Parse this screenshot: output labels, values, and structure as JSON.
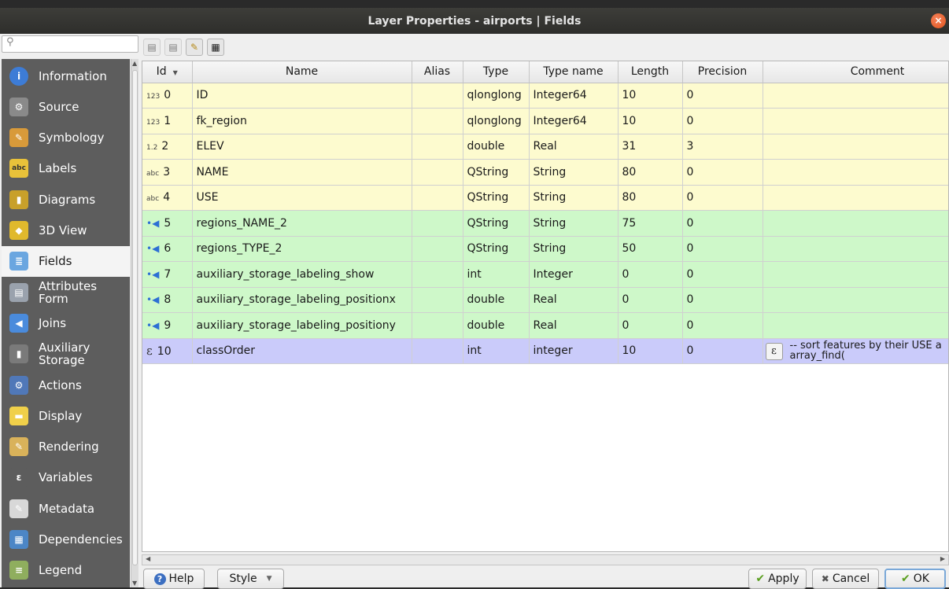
{
  "window": {
    "title": "Layer Properties - airports | Fields"
  },
  "sidebar": {
    "search_placeholder": "",
    "items": [
      {
        "label": "Information",
        "icon": "info-icon",
        "color": "#3d7cd6"
      },
      {
        "label": "Source",
        "icon": "source-icon",
        "color": "#8a8a8a"
      },
      {
        "label": "Symbology",
        "icon": "symbology-icon",
        "color": "#d89a3a"
      },
      {
        "label": "Labels",
        "icon": "labels-icon",
        "color": "#e9c23a"
      },
      {
        "label": "Diagrams",
        "icon": "diagrams-icon",
        "color": "#c8a02a"
      },
      {
        "label": "3D View",
        "icon": "3d-view-icon",
        "color": "#e0b92d"
      },
      {
        "label": "Fields",
        "icon": "fields-icon",
        "color": "#6aa6e0"
      },
      {
        "label": "Attributes Form",
        "icon": "attributes-form-icon",
        "color": "#9aa2ad"
      },
      {
        "label": "Joins",
        "icon": "joins-icon",
        "color": "#4a8bdc"
      },
      {
        "label": "Auxiliary Storage",
        "icon": "auxiliary-storage-icon",
        "color": "#7a7a7a"
      },
      {
        "label": "Actions",
        "icon": "actions-icon",
        "color": "#5078b8"
      },
      {
        "label": "Display",
        "icon": "display-icon",
        "color": "#f0d04a"
      },
      {
        "label": "Rendering",
        "icon": "rendering-icon",
        "color": "#d9b25a"
      },
      {
        "label": "Variables",
        "icon": "variables-icon",
        "color": "#5d5d5d"
      },
      {
        "label": "Metadata",
        "icon": "metadata-icon",
        "color": "#d8d8d8"
      },
      {
        "label": "Dependencies",
        "icon": "dependencies-icon",
        "color": "#4c86c6"
      },
      {
        "label": "Legend",
        "icon": "legend-icon",
        "color": "#8fae5e"
      }
    ]
  },
  "table": {
    "headers": [
      "Id",
      "Name",
      "Alias",
      "Type",
      "Type name",
      "Length",
      "Precision",
      "Comment"
    ],
    "rows": [
      {
        "kind": "yellow",
        "tag": "123",
        "id": "0",
        "name": "ID",
        "alias": "",
        "type": "qlonglong",
        "typename": "Integer64",
        "length": "10",
        "precision": "0",
        "comment": ""
      },
      {
        "kind": "yellow",
        "tag": "123",
        "id": "1",
        "name": "fk_region",
        "alias": "",
        "type": "qlonglong",
        "typename": "Integer64",
        "length": "10",
        "precision": "0",
        "comment": ""
      },
      {
        "kind": "yellow",
        "tag": "1.2",
        "id": "2",
        "name": "ELEV",
        "alias": "",
        "type": "double",
        "typename": "Real",
        "length": "31",
        "precision": "3",
        "comment": ""
      },
      {
        "kind": "yellow",
        "tag": "abc",
        "id": "3",
        "name": "NAME",
        "alias": "",
        "type": "QString",
        "typename": "String",
        "length": "80",
        "precision": "0",
        "comment": ""
      },
      {
        "kind": "yellow",
        "tag": "abc",
        "id": "4",
        "name": "USE",
        "alias": "",
        "type": "QString",
        "typename": "String",
        "length": "80",
        "precision": "0",
        "comment": ""
      },
      {
        "kind": "green",
        "tag": "",
        "id": "5",
        "name": "regions_NAME_2",
        "alias": "",
        "type": "QString",
        "typename": "String",
        "length": "75",
        "precision": "0",
        "comment": ""
      },
      {
        "kind": "green",
        "tag": "",
        "id": "6",
        "name": "regions_TYPE_2",
        "alias": "",
        "type": "QString",
        "typename": "String",
        "length": "50",
        "precision": "0",
        "comment": ""
      },
      {
        "kind": "green",
        "tag": "",
        "id": "7",
        "name": "auxiliary_storage_labeling_show",
        "alias": "",
        "type": "int",
        "typename": "Integer",
        "length": "0",
        "precision": "0",
        "comment": ""
      },
      {
        "kind": "green",
        "tag": "",
        "id": "8",
        "name": "auxiliary_storage_labeling_positionx",
        "alias": "",
        "type": "double",
        "typename": "Real",
        "length": "0",
        "precision": "0",
        "comment": ""
      },
      {
        "kind": "green",
        "tag": "",
        "id": "9",
        "name": "auxiliary_storage_labeling_positiony",
        "alias": "",
        "type": "double",
        "typename": "Real",
        "length": "0",
        "precision": "0",
        "comment": ""
      },
      {
        "kind": "purple",
        "tag": "ε",
        "id": "10",
        "name": "classOrder",
        "alias": "",
        "type": "int",
        "typename": "integer",
        "length": "10",
        "precision": "0",
        "comment": "-- sort features by their USE a array_find("
      }
    ]
  },
  "footer": {
    "help_label": "Help",
    "style_label": "Style",
    "apply_label": "Apply",
    "cancel_label": "Cancel",
    "ok_label": "OK"
  }
}
